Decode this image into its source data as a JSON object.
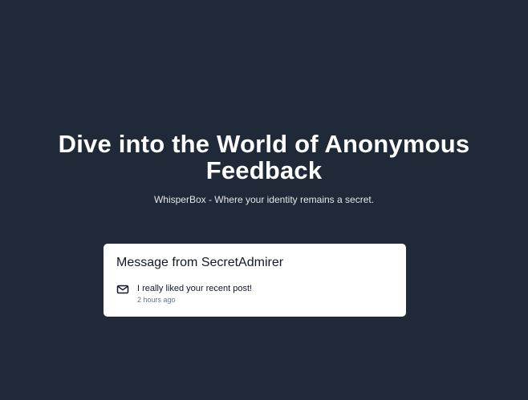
{
  "hero": {
    "title": "Dive into the World of Anonymous Feedback",
    "subtitle": "WhisperBox - Where your identity remains a secret."
  },
  "card": {
    "title": "Message from SecretAdmirer",
    "icon": "mail-icon",
    "message": "I really liked your recent post!",
    "time": "2 hours ago"
  },
  "colors": {
    "background": "#1f2937",
    "card": "#ffffff",
    "text_primary": "#111827",
    "text_muted": "#64748b"
  }
}
